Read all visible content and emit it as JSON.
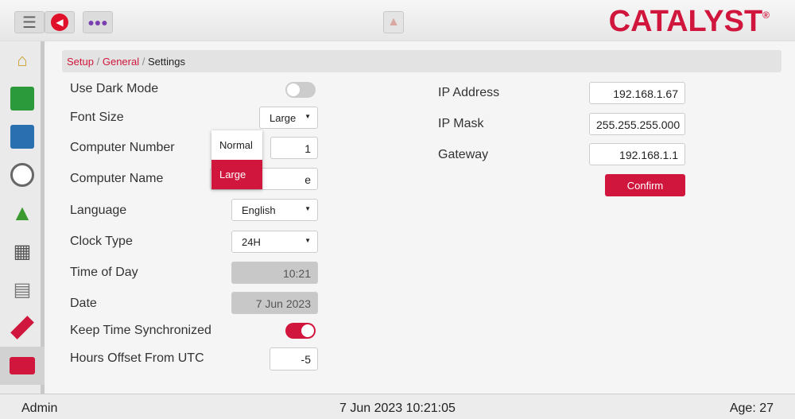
{
  "header": {
    "logo": "CATALYST",
    "logo_mark": "®",
    "icons": [
      "menu-icon",
      "back-icon",
      "users-icon",
      "warning-icon"
    ]
  },
  "sidebar": {
    "items": [
      "climate-control",
      "fan-temperature",
      "ventilation",
      "clock",
      "growth-curve",
      "feed-calculator",
      "calendar-report",
      "usb-drive",
      "setup-toolbox"
    ]
  },
  "breadcrumb": {
    "setup": "Setup",
    "general": "General",
    "current": "Settings",
    "sep": "/"
  },
  "settings": {
    "dark_mode": {
      "label": "Use Dark Mode",
      "on": false
    },
    "font_size": {
      "label": "Font Size",
      "value": "Large",
      "options": [
        "Normal",
        "Large"
      ]
    },
    "computer_number": {
      "label": "Computer Number",
      "value": "1"
    },
    "computer_name": {
      "label": "Computer Name",
      "value": "e"
    },
    "language": {
      "label": "Language",
      "value": "English"
    },
    "clock_type": {
      "label": "Clock Type",
      "value": "24H"
    },
    "time_of_day": {
      "label": "Time of Day",
      "value": "10:21"
    },
    "date": {
      "label": "Date",
      "value": "7 Jun 2023"
    },
    "keep_sync": {
      "label": "Keep Time Synchronized",
      "on": true
    },
    "utc_offset": {
      "label": "Hours Offset From UTC",
      "value": "-5"
    }
  },
  "network": {
    "ip": {
      "label": "IP Address",
      "value": "192.168.1.67"
    },
    "mask": {
      "label": "IP Mask",
      "value": "255.255.255.000"
    },
    "gateway": {
      "label": "Gateway",
      "value": "192.168.1.1"
    },
    "confirm": "Confirm"
  },
  "status": {
    "user": "Admin",
    "datetime": "7 Jun 2023 10:21:05",
    "age": "Age: 27"
  },
  "colors": {
    "accent": "#d0163c"
  }
}
